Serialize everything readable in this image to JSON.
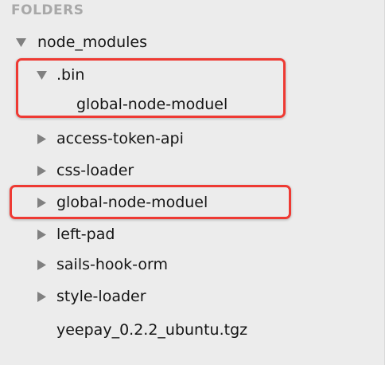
{
  "sidebar": {
    "header": "FOLDERS",
    "tree": {
      "root": {
        "label": "node_modules",
        "expanded": true,
        "arrow_icon": "triangle-down-icon"
      },
      "bin": {
        "label": ".bin",
        "expanded": true,
        "arrow_icon": "triangle-down-icon"
      },
      "bin_child": {
        "label": "global-node-moduel"
      },
      "access_token_api": {
        "label": "access-token-api",
        "expanded": false,
        "arrow_icon": "triangle-right-icon"
      },
      "css_loader": {
        "label": "css-loader",
        "expanded": false,
        "arrow_icon": "triangle-right-icon"
      },
      "global_node_moduel": {
        "label": "global-node-moduel",
        "expanded": false,
        "arrow_icon": "triangle-right-icon"
      },
      "left_pad": {
        "label": "left-pad",
        "expanded": false,
        "arrow_icon": "triangle-right-icon"
      },
      "sails_hook_orm": {
        "label": "sails-hook-orm",
        "expanded": false,
        "arrow_icon": "triangle-right-icon"
      },
      "style_loader": {
        "label": "style-loader",
        "expanded": false,
        "arrow_icon": "triangle-right-icon"
      },
      "tgz_file": {
        "label": "yeepay_0.2.2_ubuntu.tgz"
      }
    }
  },
  "colors": {
    "background": "#ececec",
    "header_text": "#a8a8a8",
    "item_text": "#151515",
    "arrow": "#808080",
    "highlight_border": "#ee3a33"
  }
}
